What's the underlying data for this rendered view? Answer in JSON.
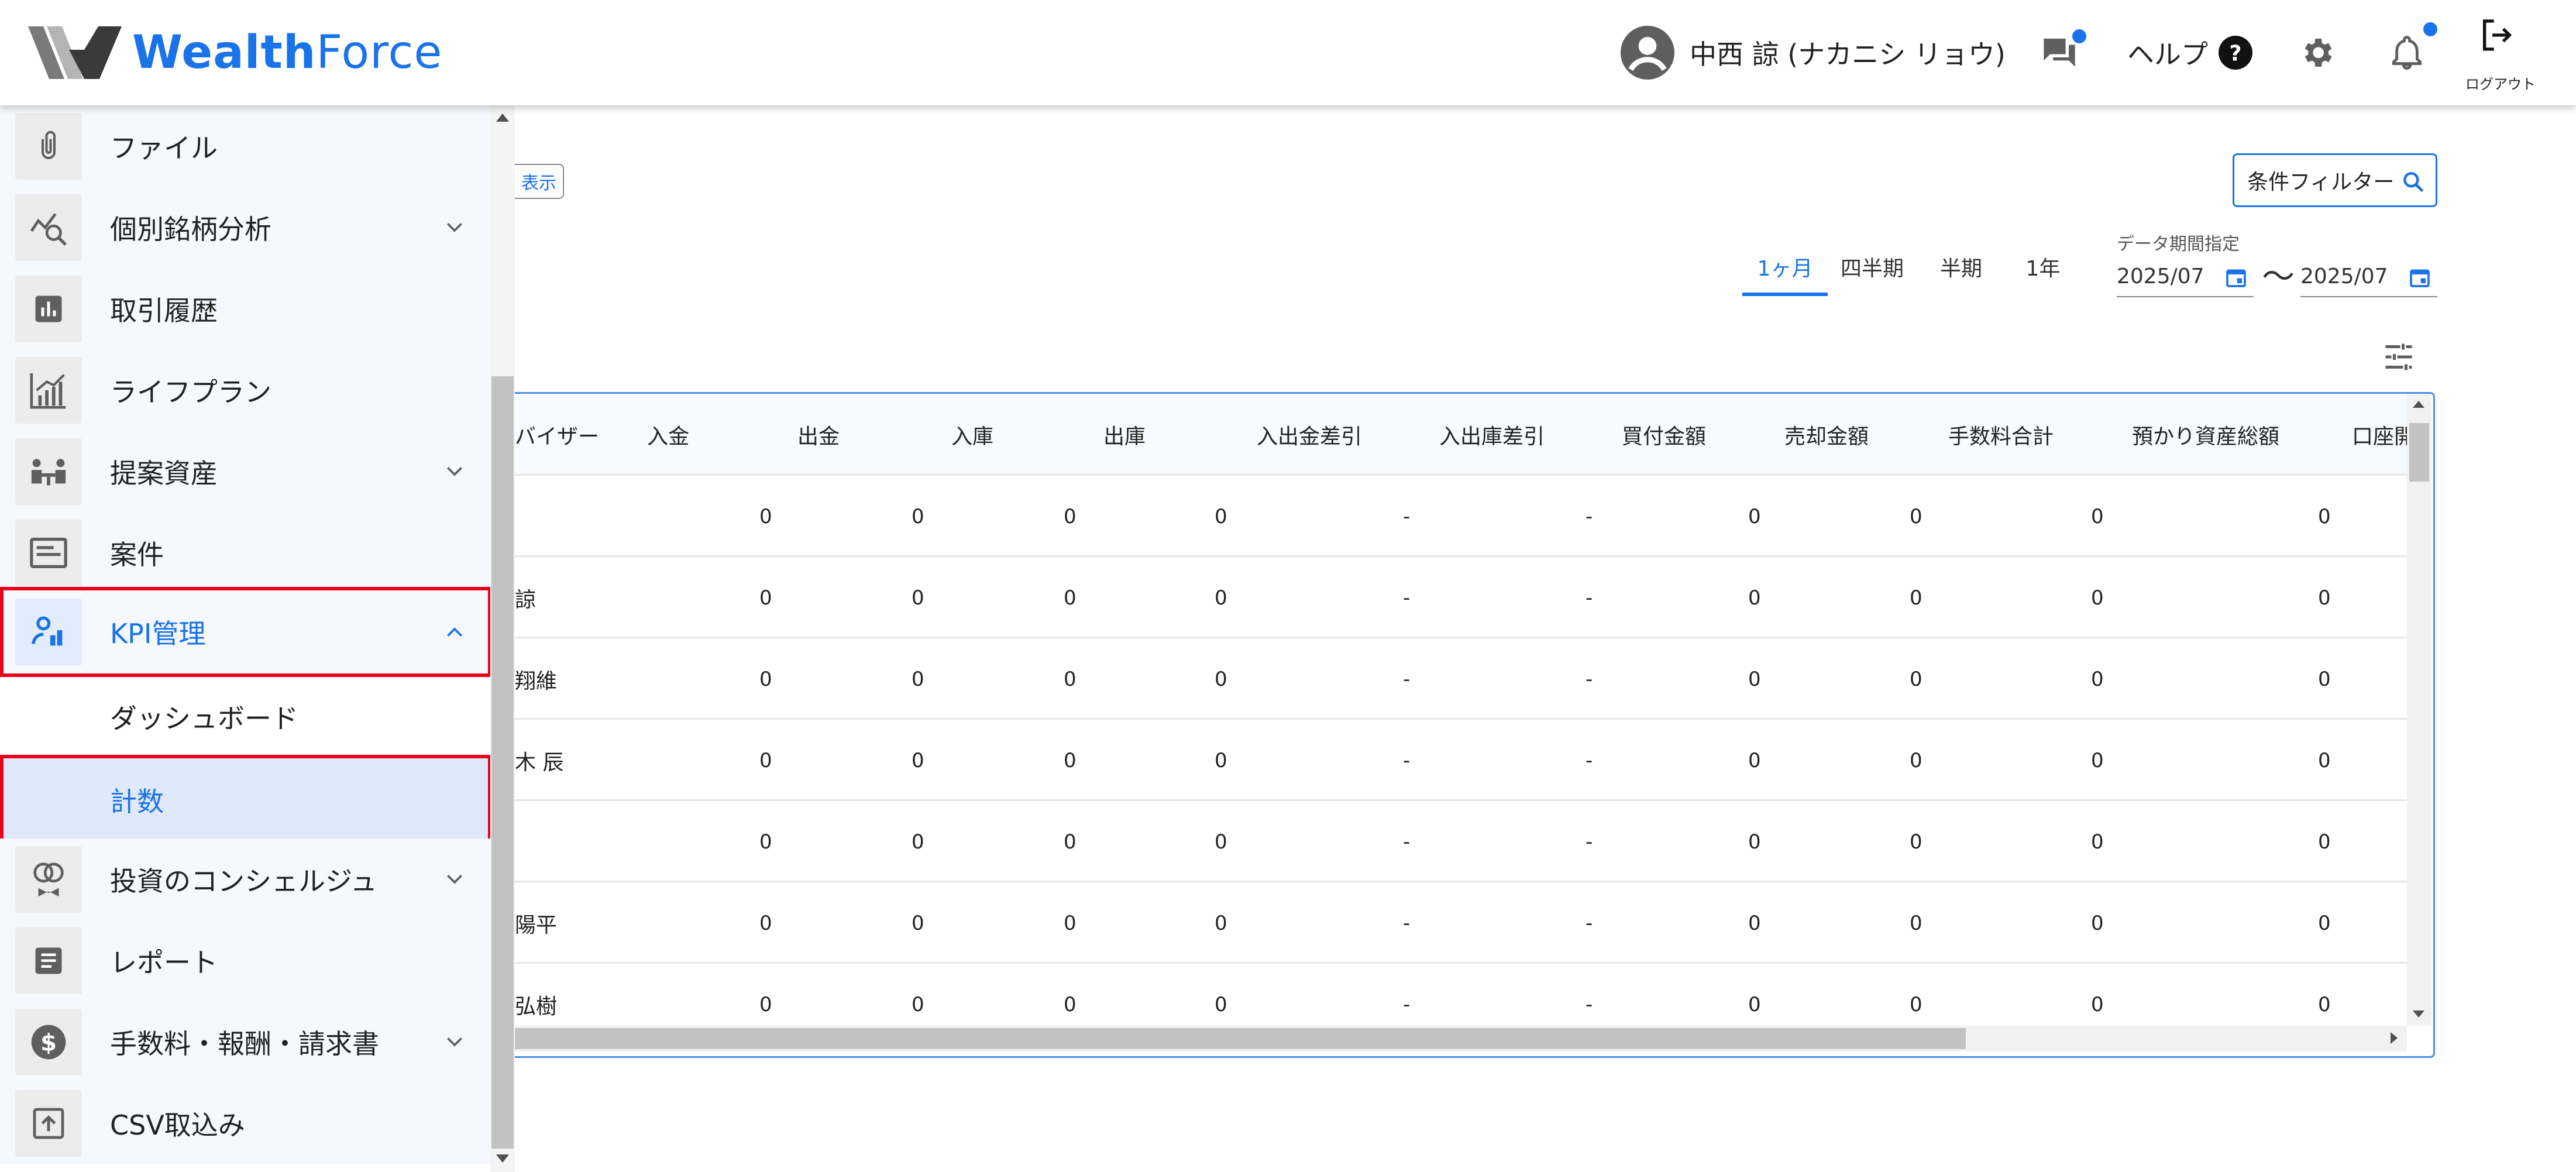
{
  "app": {
    "brand_wealth": "Wealth",
    "brand_force": "Force",
    "brand_color": "#1a73e8"
  },
  "header": {
    "user_name": "中西 諒 (ナカニシ リョウ)",
    "help_label": "ヘルプ",
    "logout_label": "ログアウト",
    "icons": [
      "account-circle-icon",
      "chat-icon",
      "help-circle-icon",
      "gear-icon",
      "bell-icon",
      "logout-icon"
    ]
  },
  "sidebar": {
    "items": [
      {
        "label": "ファイル",
        "icon": "paperclip-icon",
        "expandable": false
      },
      {
        "label": "個別銘柄分析",
        "icon": "chart-search-icon",
        "expandable": true
      },
      {
        "label": "取引履歴",
        "icon": "bar-chart-icon",
        "expandable": false
      },
      {
        "label": "ライフプラン",
        "icon": "growth-chart-icon",
        "expandable": false
      },
      {
        "label": "提案資産",
        "icon": "meeting-icon",
        "expandable": true
      },
      {
        "label": "案件",
        "icon": "card-icon",
        "expandable": false
      },
      {
        "label": "KPI管理",
        "icon": "kpi-icon",
        "expandable": true,
        "expanded": true,
        "active": true
      },
      {
        "label": "投資のコンシェルジュ",
        "icon": "concierge-icon",
        "expandable": true
      },
      {
        "label": "レポート",
        "icon": "document-icon",
        "expandable": false
      },
      {
        "label": "手数料・報酬・請求書",
        "icon": "dollar-icon",
        "expandable": true
      },
      {
        "label": "CSV取込み",
        "icon": "upload-icon",
        "expandable": false
      }
    ],
    "kpi_subitems": [
      {
        "label": "ダッシュボード",
        "selected": false
      },
      {
        "label": "計数",
        "selected": true
      }
    ],
    "highlight_color": "#e8001c"
  },
  "toolbar": {
    "display_button": "表示",
    "filter_button": "条件フィルター",
    "period_tabs": [
      "1ヶ月",
      "四半期",
      "半期",
      "1年"
    ],
    "active_period": "1ヶ月",
    "date_caption": "データ期間指定",
    "date_from": "2025/07",
    "date_to": "2025/07",
    "range_separator": "〜"
  },
  "table": {
    "columns": [
      "バイザー",
      "入金",
      "出金",
      "入庫",
      "出庫",
      "入出金差引",
      "入出庫差引",
      "買付金額",
      "売却金額",
      "手数料合計",
      "預かり資産総額",
      "口座開"
    ],
    "rows": [
      {
        "name": "",
        "values": [
          "0",
          "0",
          "0",
          "0",
          "-",
          "-",
          "0",
          "0",
          "0",
          "0"
        ]
      },
      {
        "name": "諒",
        "values": [
          "0",
          "0",
          "0",
          "0",
          "-",
          "-",
          "0",
          "0",
          "0",
          "0"
        ]
      },
      {
        "name": "翔維",
        "values": [
          "0",
          "0",
          "0",
          "0",
          "-",
          "-",
          "0",
          "0",
          "0",
          "0"
        ]
      },
      {
        "name": "木 辰",
        "values": [
          "0",
          "0",
          "0",
          "0",
          "-",
          "-",
          "0",
          "0",
          "0",
          "0"
        ]
      },
      {
        "name": "",
        "values": [
          "0",
          "0",
          "0",
          "0",
          "-",
          "-",
          "0",
          "0",
          "0",
          "0"
        ]
      },
      {
        "name": "陽平",
        "values": [
          "0",
          "0",
          "0",
          "0",
          "-",
          "-",
          "0",
          "0",
          "0",
          "0"
        ]
      },
      {
        "name": "弘樹",
        "values": [
          "0",
          "0",
          "0",
          "0",
          "-",
          "-",
          "0",
          "0",
          "0",
          "0"
        ]
      }
    ]
  }
}
